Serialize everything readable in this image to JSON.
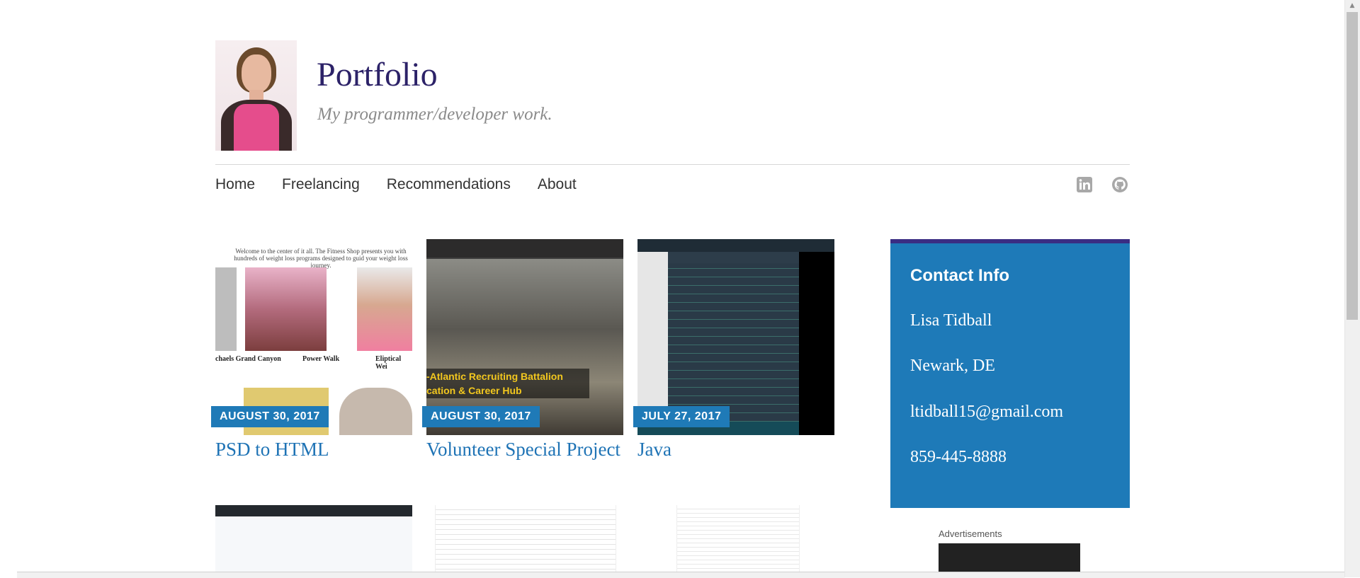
{
  "site": {
    "title": "Portfolio",
    "tagline": "My programmer/developer work."
  },
  "nav": {
    "items": [
      {
        "label": "Home"
      },
      {
        "label": "Freelancing"
      },
      {
        "label": "Recommendations"
      },
      {
        "label": "About"
      }
    ],
    "social": [
      "linkedin-icon",
      "github-icon"
    ]
  },
  "posts": [
    {
      "date": "AUGUST 30, 2017",
      "title": "PSD to HTML",
      "thumb_text": {
        "caption": "Welcome to the center of it all. The Fitness Shop presents you with hundreds of weight loss programs designed to guid your weight loss journey.",
        "labels": [
          "chaels Grand Canyon",
          "Power Walk",
          "Eliptical Wei"
        ]
      }
    },
    {
      "date": "AUGUST 30, 2017",
      "title": "Volunteer Special Project",
      "thumb_text": {
        "banner_line1": "-Atlantic Recruiting Battalion",
        "banner_line2": "cation & Career Hub"
      }
    },
    {
      "date": "JULY 27, 2017",
      "title": "Java"
    }
  ],
  "contact": {
    "heading": "Contact Info",
    "name": "Lisa Tidball",
    "location": "Newark, DE",
    "email": "ltidball15@gmail.com",
    "phone": "859-445-8888"
  },
  "ads": {
    "label": "Advertisements"
  },
  "colors": {
    "title": "#2c2268",
    "link": "#1e73b5",
    "date_badge": "#1f7ab7",
    "widget_bg": "#1e7ab8",
    "widget_border": "#3a2d83"
  }
}
